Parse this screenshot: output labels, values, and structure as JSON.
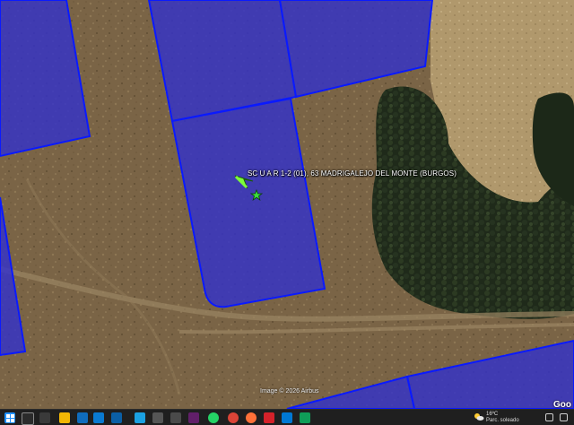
{
  "map": {
    "place_label": "SC U A  R 1-2 (01), 63   MADRIGALEJO DEL MONTE (BURGOS)",
    "copyright": "Image © 2026 Airbus",
    "logo": "Goo",
    "marker_icon": "green-arrow-pointer-icon",
    "pin_icon": "green-star-icon",
    "parcel_color": "#2f2fd0",
    "parcel_border": "#0a1aff"
  },
  "taskbar": {
    "icons": [
      "start-icon",
      "search-icon",
      "task-view-icon",
      "file-explorer-icon",
      "store-icon",
      "mail-icon",
      "photos-icon",
      "edge-icon",
      "files-icon",
      "save-icon",
      "slack-icon",
      "whatsapp-icon",
      "chrome-icon",
      "firefox-icon",
      "acrobat-icon",
      "skype-icon",
      "sheets-icon"
    ],
    "weather_temp": "16ºC",
    "weather_desc": "Parc. soleado"
  }
}
